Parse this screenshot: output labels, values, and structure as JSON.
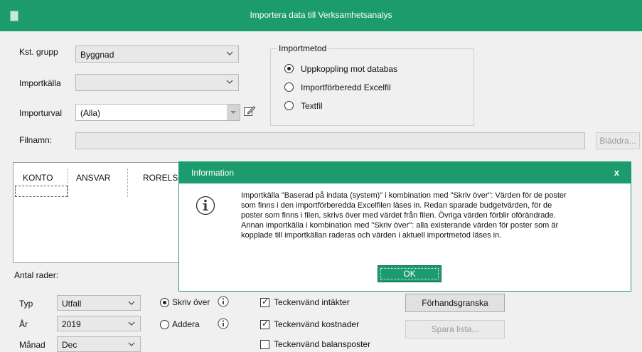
{
  "window": {
    "title": "Importera data till Verksamhetsanalys"
  },
  "form": {
    "kst_grupp_label": "Kst. grupp",
    "kst_grupp_value": "Byggnad",
    "importkalla_label": "Importkälla",
    "importkalla_value": "",
    "importurval_label": "Importurval",
    "importurval_value": "(Alla)",
    "filnamn_label": "Filnamn:",
    "filnamn_value": "",
    "bladdra_label": "Bläddra..."
  },
  "importmetod": {
    "legend": "Importmetod",
    "options": [
      {
        "label": "Uppkoppling mot databas",
        "selected": true
      },
      {
        "label": "Importförberedd Excelfil",
        "selected": false
      },
      {
        "label": "Textfil",
        "selected": false
      }
    ]
  },
  "grid": {
    "columns": [
      "KONTO",
      "ANSVAR",
      "RORELSE"
    ]
  },
  "bottom": {
    "antal_rader_label": "Antal rader:",
    "typ_label": "Typ",
    "typ_value": "Utfall",
    "ar_label": "År",
    "ar_value": "2019",
    "manad_label": "Månad",
    "manad_value": "Dec",
    "skriv_over_label": "Skriv över",
    "addera_label": "Addera",
    "checks": [
      {
        "label": "Teckenvänd intäkter",
        "checked": true
      },
      {
        "label": "Teckenvänd kostnader",
        "checked": true
      },
      {
        "label": "Teckenvänd balansposter",
        "checked": false
      }
    ],
    "forhandsgranska_label": "Förhandsgranska",
    "spara_lista_label": "Spara lista..."
  },
  "dialog": {
    "title": "Information",
    "close": "x",
    "lines": [
      "Importkälla \"Baserad på indata (system)\" i kombination med \"Skriv över\": Värden för de poster",
      "som finns i den importförberedda Excelfilen läses in.  Redan sparade budgetvärden, för de",
      "poster som finns i filen, skrivs över med värdet från filen. Övriga värden förblir oförändrade.",
      "Annan importkälla i kombination med \"Skriv över\": alla existerande värden för poster som är",
      "kopplade till importkällan raderas och värden i aktuell importmetod läses in."
    ],
    "ok_label": "OK"
  },
  "colors": {
    "accent": "#1c9c6e"
  }
}
